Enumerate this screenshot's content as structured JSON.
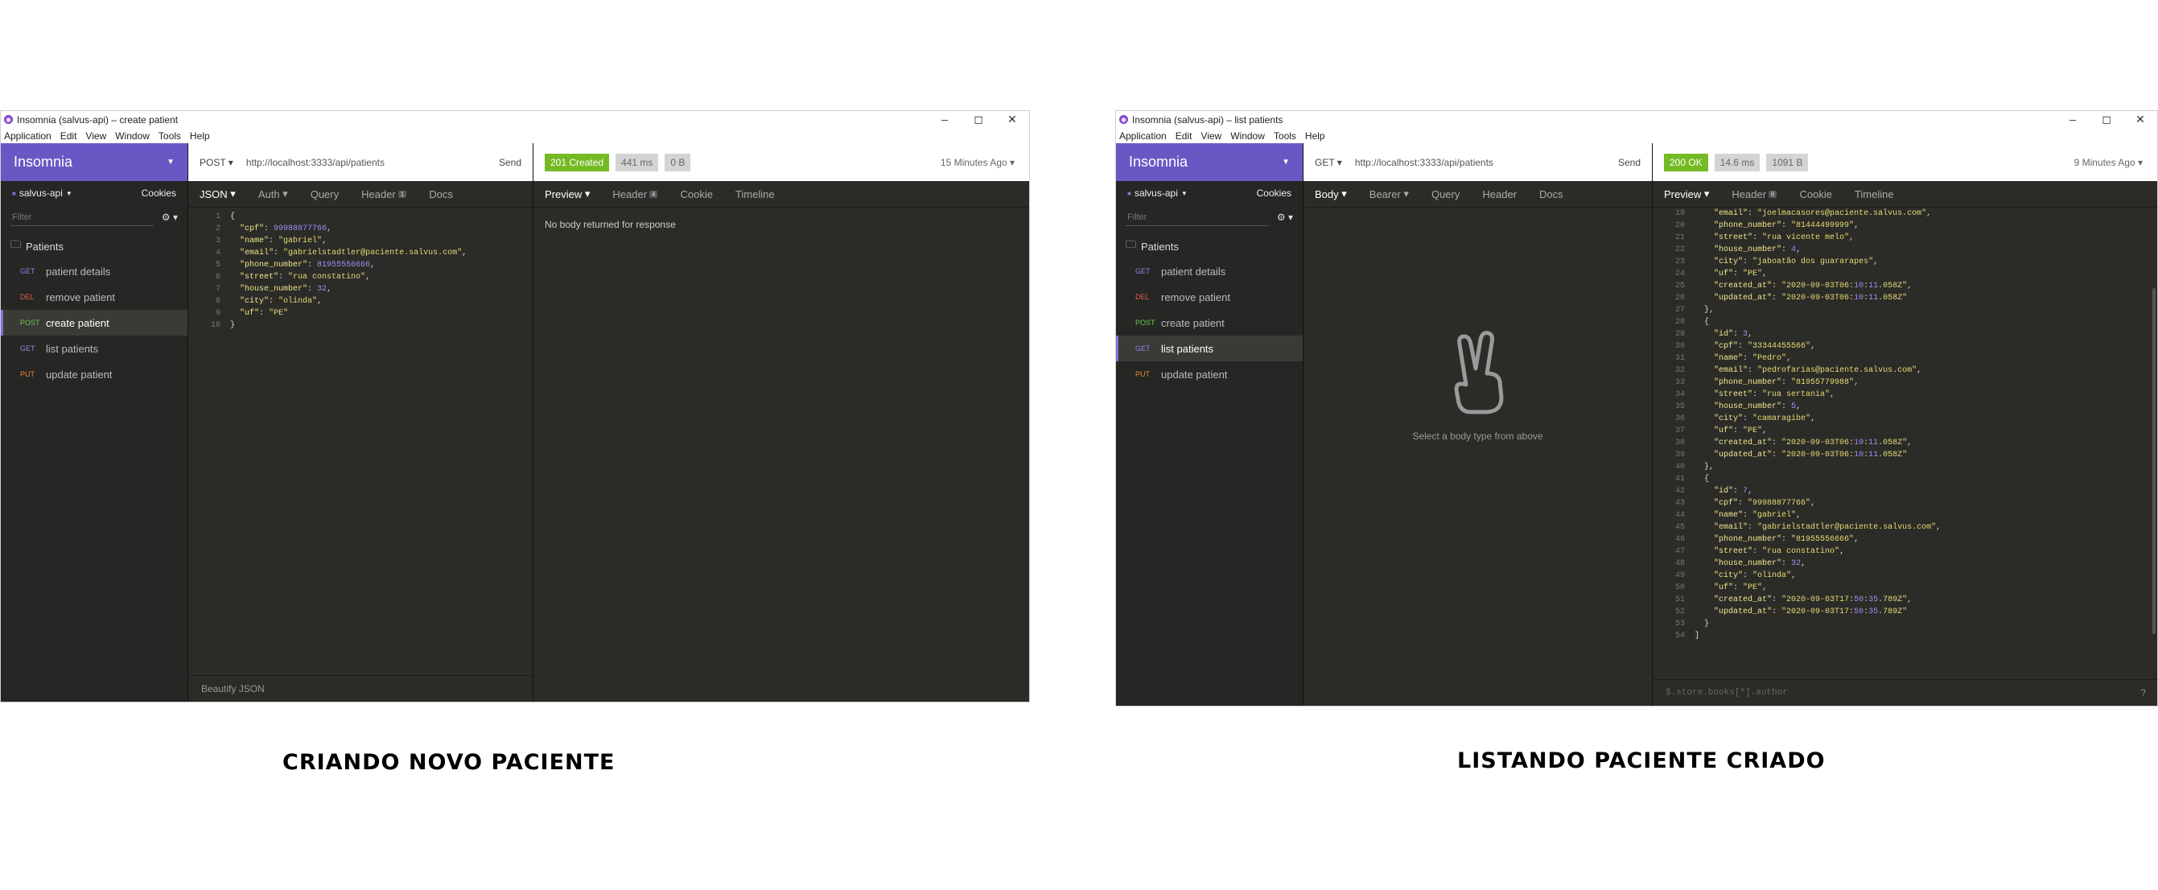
{
  "window1": {
    "title": "Insomnia (salvus-api) – create patient",
    "menu": [
      "Application",
      "Edit",
      "View",
      "Window",
      "Tools",
      "Help"
    ],
    "brand": "Insomnia",
    "workspace": "salvus-api",
    "cookies": "Cookies",
    "filter_placeholder": "Filter",
    "folder": "Patients",
    "requests": [
      {
        "method": "GET",
        "name": "patient details"
      },
      {
        "method": "DEL",
        "name": "remove patient"
      },
      {
        "method": "POST",
        "name": "create patient"
      },
      {
        "method": "GET",
        "name": "list patients"
      },
      {
        "method": "PUT",
        "name": "update patient"
      }
    ],
    "method": "POST",
    "url": "http://localhost:3333/api/patients",
    "send": "Send",
    "status": "201 Created",
    "time": "441 ms",
    "size": "0 B",
    "ago": "15 Minutes Ago",
    "req_tabs": [
      "JSON",
      "Auth",
      "Query",
      "Header",
      "Docs"
    ],
    "header_count": "1",
    "resp_tabs": [
      "Preview",
      "Header",
      "Cookie",
      "Timeline"
    ],
    "resp_header_count": "4",
    "no_body": "No body returned for response",
    "footer": "Beautify JSON",
    "body_lines": [
      [
        "1",
        "{"
      ],
      [
        "2",
        "  \"cpf\": 99988877766,"
      ],
      [
        "3",
        "  \"name\": \"gabriel\","
      ],
      [
        "4",
        "  \"email\": \"gabrielstadtler@paciente.salvus.com\","
      ],
      [
        "5",
        "  \"phone_number\": 81955556666,"
      ],
      [
        "6",
        "  \"street\": \"rua constatino\","
      ],
      [
        "7",
        "  \"house_number\": 32,"
      ],
      [
        "8",
        "  \"city\": \"olinda\","
      ],
      [
        "9",
        "  \"uf\": \"PE\""
      ],
      [
        "10",
        "}"
      ]
    ]
  },
  "window2": {
    "title": "Insomnia (salvus-api) – list patients",
    "menu": [
      "Application",
      "Edit",
      "View",
      "Window",
      "Tools",
      "Help"
    ],
    "brand": "Insomnia",
    "workspace": "salvus-api",
    "cookies": "Cookies",
    "filter_placeholder": "Filter",
    "folder": "Patients",
    "requests": [
      {
        "method": "GET",
        "name": "patient details"
      },
      {
        "method": "DEL",
        "name": "remove patient"
      },
      {
        "method": "POST",
        "name": "create patient"
      },
      {
        "method": "GET",
        "name": "list patients"
      },
      {
        "method": "PUT",
        "name": "update patient"
      }
    ],
    "method": "GET",
    "url": "http://localhost:3333/api/patients",
    "send": "Send",
    "status": "200 OK",
    "time": "14.6 ms",
    "size": "1091 B",
    "ago": "9 Minutes Ago",
    "req_tabs": [
      "Body",
      "Bearer",
      "Query",
      "Header",
      "Docs"
    ],
    "resp_tabs": [
      "Preview",
      "Header",
      "Cookie",
      "Timeline"
    ],
    "resp_header_count": "6",
    "empty_body": "Select a body type from above",
    "filter_footer": "$.store.books[*].author",
    "resp_lines": [
      [
        "19",
        "    \"email\": \"joelmacasores@paciente.salvus.com\","
      ],
      [
        "20",
        "    \"phone_number\": \"81444499999\","
      ],
      [
        "21",
        "    \"street\": \"rua vicente melo\","
      ],
      [
        "22",
        "    \"house_number\": 4,"
      ],
      [
        "23",
        "    \"city\": \"jaboatão dos guararapes\","
      ],
      [
        "24",
        "    \"uf\": \"PE\","
      ],
      [
        "25",
        "    \"created_at\": \"2020-09-03T06:10:11.058Z\","
      ],
      [
        "26",
        "    \"updated_at\": \"2020-09-03T06:10:11.058Z\""
      ],
      [
        "27",
        "  },"
      ],
      [
        "28",
        "  {"
      ],
      [
        "29",
        "    \"id\": 3,"
      ],
      [
        "30",
        "    \"cpf\": \"33344455566\","
      ],
      [
        "31",
        "    \"name\": \"Pedro\","
      ],
      [
        "32",
        "    \"email\": \"pedrofarias@paciente.salvus.com\","
      ],
      [
        "33",
        "    \"phone_number\": \"81955779988\","
      ],
      [
        "34",
        "    \"street\": \"rua sertania\","
      ],
      [
        "35",
        "    \"house_number\": 5,"
      ],
      [
        "36",
        "    \"city\": \"camaragibe\","
      ],
      [
        "37",
        "    \"uf\": \"PE\","
      ],
      [
        "38",
        "    \"created_at\": \"2020-09-03T06:10:11.058Z\","
      ],
      [
        "39",
        "    \"updated_at\": \"2020-09-03T06:10:11.058Z\""
      ],
      [
        "40",
        "  },"
      ],
      [
        "41",
        "  {"
      ],
      [
        "42",
        "    \"id\": 7,"
      ],
      [
        "43",
        "    \"cpf\": \"99988877766\","
      ],
      [
        "44",
        "    \"name\": \"gabriel\","
      ],
      [
        "45",
        "    \"email\": \"gabrielstadtler@paciente.salvus.com\","
      ],
      [
        "46",
        "    \"phone_number\": \"81955556666\","
      ],
      [
        "47",
        "    \"street\": \"rua constatino\","
      ],
      [
        "48",
        "    \"house_number\": 32,"
      ],
      [
        "49",
        "    \"city\": \"olinda\","
      ],
      [
        "50",
        "    \"uf\": \"PE\","
      ],
      [
        "51",
        "    \"created_at\": \"2020-09-03T17:50:35.789Z\","
      ],
      [
        "52",
        "    \"updated_at\": \"2020-09-03T17:50:35.789Z\""
      ],
      [
        "53",
        "  }"
      ],
      [
        "54",
        "]"
      ]
    ]
  },
  "captions": {
    "left": "CRIANDO NOVO PACIENTE",
    "right": "LISTANDO PACIENTE CRIADO"
  }
}
